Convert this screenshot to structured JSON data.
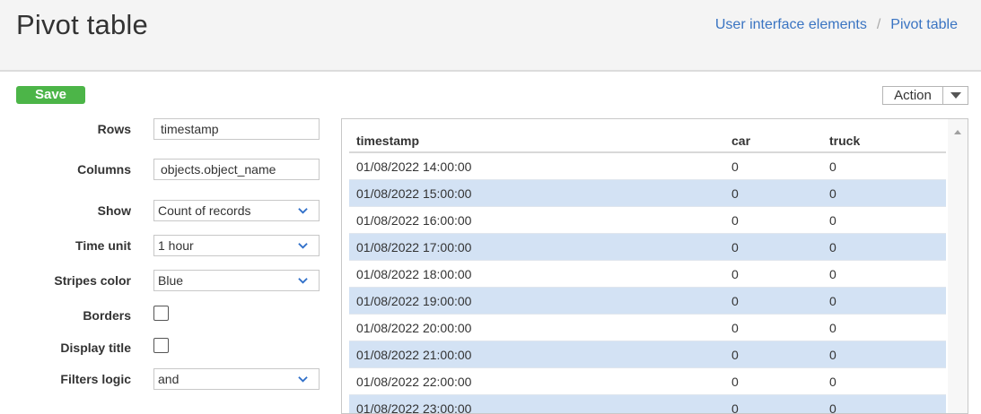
{
  "header": {
    "title": "Pivot table",
    "breadcrumb": {
      "parent": "User interface elements",
      "separator": "/",
      "current": "Pivot table"
    }
  },
  "toolbar": {
    "save_label": "Save",
    "action_label": "Action"
  },
  "form": {
    "rows_label": "Rows",
    "rows_value": "timestamp",
    "columns_label": "Columns",
    "columns_value": "objects.object_name",
    "show_label": "Show",
    "show_value": "Count of records",
    "time_unit_label": "Time unit",
    "time_unit_value": "1 hour",
    "stripes_color_label": "Stripes color",
    "stripes_color_value": "Blue",
    "borders_label": "Borders",
    "borders_checked": false,
    "display_title_label": "Display title",
    "display_title_checked": false,
    "filters_logic_label": "Filters logic",
    "filters_logic_value": "and"
  },
  "table": {
    "columns": [
      "timestamp",
      "car",
      "truck"
    ],
    "rows": [
      [
        "01/08/2022 14:00:00",
        "0",
        "0"
      ],
      [
        "01/08/2022 15:00:00",
        "0",
        "0"
      ],
      [
        "01/08/2022 16:00:00",
        "0",
        "0"
      ],
      [
        "01/08/2022 17:00:00",
        "0",
        "0"
      ],
      [
        "01/08/2022 18:00:00",
        "0",
        "0"
      ],
      [
        "01/08/2022 19:00:00",
        "0",
        "0"
      ],
      [
        "01/08/2022 20:00:00",
        "0",
        "0"
      ],
      [
        "01/08/2022 21:00:00",
        "0",
        "0"
      ],
      [
        "01/08/2022 22:00:00",
        "0",
        "0"
      ],
      [
        "01/08/2022 23:00:00",
        "0",
        "0"
      ]
    ]
  },
  "colors": {
    "save_button": "#4cb548",
    "stripe": "#d3e2f4",
    "link": "#3a74c2",
    "select_caret": "#2f6fc9"
  }
}
